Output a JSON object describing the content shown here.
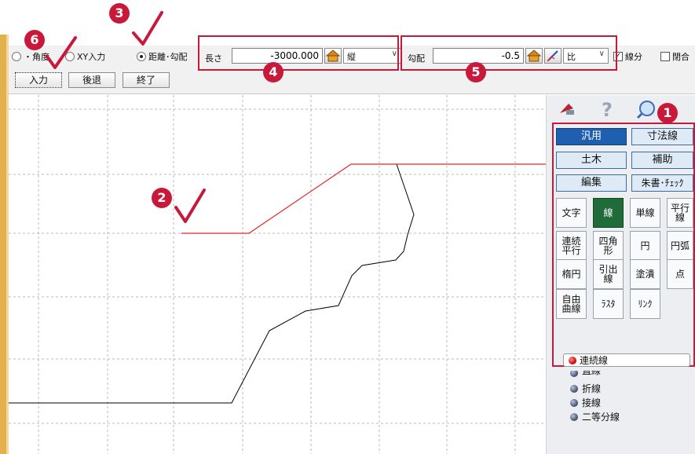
{
  "colors": {
    "accent_red": "#c9193a",
    "category_selected": "#1f5fb0",
    "tool_selected": "#1f6b3a",
    "sketch_line": "#000000",
    "preview_line": "#e0282c"
  },
  "toolbar": {
    "radio_angle": "・角度",
    "radio_xy": "XY入力",
    "radio_dist": "距離･勾配",
    "length_label": "長さ",
    "length_value": "-3000.000",
    "direction_select": "縦",
    "slope_label": "勾配",
    "slope_value": "-0.5",
    "ratio_select": "比",
    "check_segment": "線分",
    "check_segment_checked": "✓",
    "check_close": "閉合",
    "btn_input": "入力",
    "btn_back": "後退",
    "btn_finish": "終了"
  },
  "badges": {
    "b1": "1",
    "b2": "2",
    "b3": "3",
    "b4": "4",
    "b5": "5",
    "b6": "6"
  },
  "palette": {
    "icons": [
      "pin-icon",
      "help-icon",
      "search-icon"
    ],
    "categories": [
      "汎用",
      "寸法線",
      "土木",
      "補助",
      "編集",
      "朱書･ﾁｪｯｸ"
    ],
    "tools": [
      "文字",
      "線",
      "単線",
      "平行\n線",
      "連続\n平行",
      "四角\n形",
      "円",
      "円弧",
      "楕円",
      "引出\n線",
      "塗潰",
      "点",
      "自由\n曲線",
      "ﾗｽﾀ",
      "ﾘﾝｸ"
    ],
    "current_mode": "連続線",
    "sub_items": [
      "直線",
      "折線",
      "接線",
      "二等分線"
    ]
  }
}
